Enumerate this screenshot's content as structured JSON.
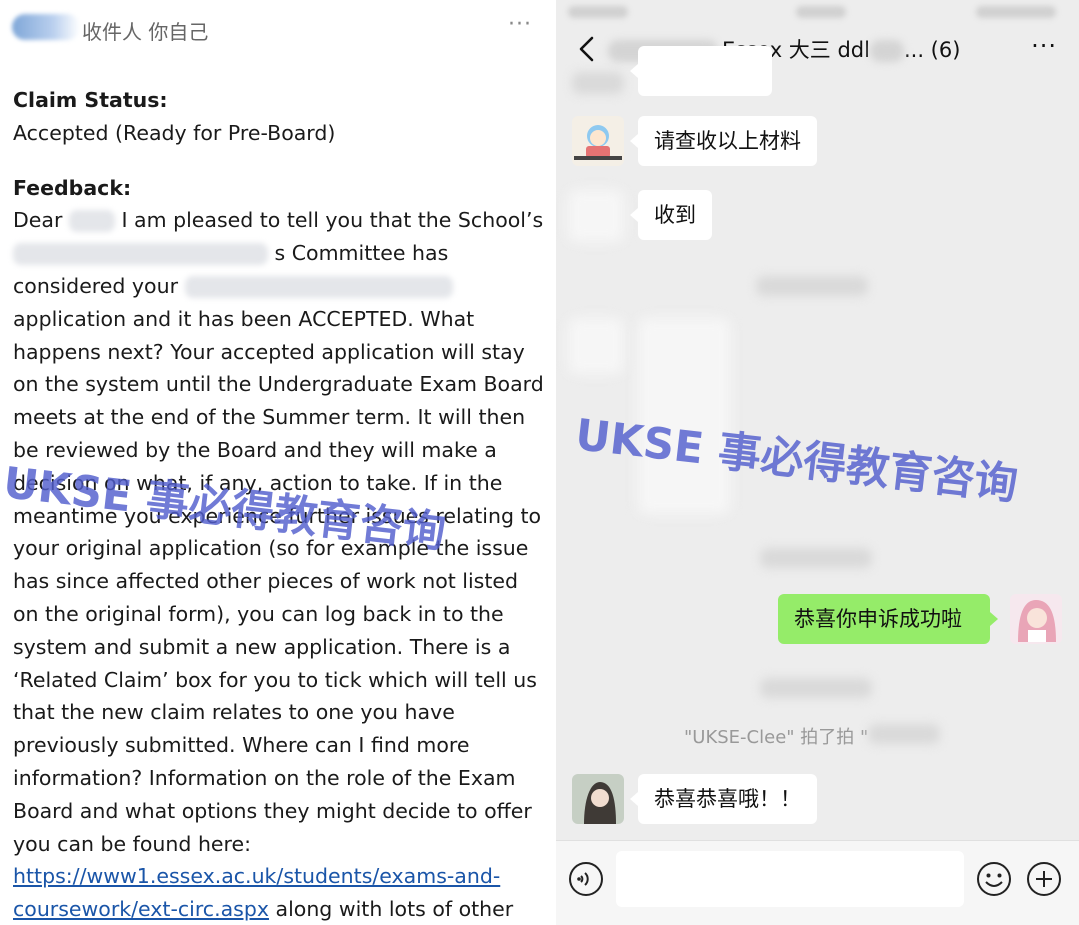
{
  "email": {
    "recipient_label": "收件人 你自己",
    "more_label": "···",
    "claim_status_label": "Claim Status:",
    "claim_status_value": "Accepted (Ready for Pre-Board)",
    "feedback_label": "Feedback:",
    "p1_a": "Dear",
    "p1_b": "I am pleased to tell you that the School’s",
    "p2": "s Committee has",
    "p3": "considered your",
    "p4": "application and it has been ACCEPTED. What happens next? Your accepted application will stay on the system until the Undergraduate Exam Board meets at the end of the Summer term. It will then be reviewed by the Board and they will make a decision on what, if any, action to take. If in the meantime you experience further issues relating to your original application (so for example the issue has since affected other pieces of work not listed on the original form), you can log back in to the system and submit a new application. There is a ‘Related Claim’ box for you to tick which will tell us that the new claim relates to one you have previously submitted. Where can I find more information? Information on the role of the Exam Board and what options they might decide to offer you can be found here:",
    "link": "https://www1.essex.ac.uk/students/exams-and-coursework/ext-circ.aspx",
    "p5": "along with lots of other useful information about the process. Can you tell"
  },
  "chat": {
    "title": "Essex 大三 ddl",
    "title_suffix": "... (6)",
    "more_label": "···",
    "messages": [
      {
        "text": "请查收以上材料"
      },
      {
        "text": "收到"
      },
      {
        "text": "恭喜你申诉成功啦"
      },
      {
        "text": "恭喜恭喜哦！！"
      }
    ],
    "system_note": "\"UKSE-Clee\" 拍了拍 \"",
    "input_placeholder": ""
  },
  "watermark": {
    "left": "UKSE 事必得教育咨询",
    "right": "UKSE 事必得教育咨询"
  },
  "colors": {
    "chat_bg": "#ededed",
    "green_bubble": "#95ec69",
    "link": "#1a55a8",
    "watermark": "#525ecd"
  }
}
